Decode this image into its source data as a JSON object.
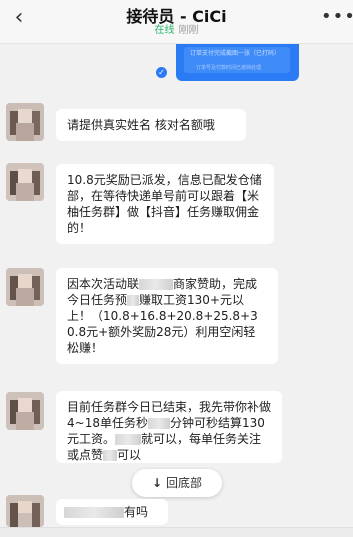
{
  "header": {
    "back_icon": "‹",
    "title": "接待员 - CiCi",
    "status": "在线",
    "status_time": "刚刚",
    "more_icon": "•••"
  },
  "outgoing_card": {
    "line1": "订单支付完成截图一张（已打码）",
    "line2": "订单号及付款时间已遮挡处理",
    "read_icon": "✓"
  },
  "messages": [
    {
      "text": "请提供真实姓名 核对名额哦"
    },
    {
      "text": "10.8元奖励已派发，信息已配发仓储部，在等待快递单号前可以跟着【米柚任务群】做【抖音】任务赚取佣金的！"
    },
    {
      "part1": "因本次活动联",
      "part2": "商家赞助，完成今日任务预",
      "part3": "赚取工资130+元以上！（10.8+16.8+20.8+25.8+30.8元+额外奖励28元）利用空闲轻松赚！"
    },
    {
      "part1": "目前任务群今日已结束，我先带你补做4~18单任务秒",
      "part2": "分钟可秒结算130元工资。",
      "part3": "就可以，每单任务关注或点赞",
      "part4": "可以"
    },
    {
      "text": "有吗"
    }
  ],
  "back_to_bottom": {
    "arrow": "↓",
    "label": "回底部"
  },
  "colors": {
    "accent_blue": "#2b7bf5",
    "online_green": "#2ab26b",
    "background": "#f1f1f1",
    "bubble": "#ffffff"
  }
}
